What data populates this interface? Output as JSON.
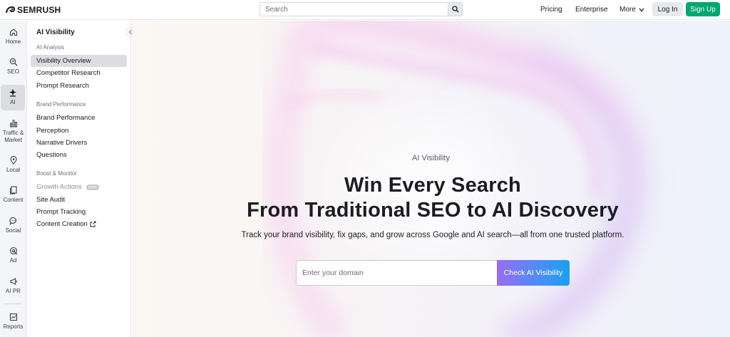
{
  "brand": {
    "name": "SEMRUSH"
  },
  "topbar": {
    "search_placeholder": "Search",
    "nav": {
      "pricing": "Pricing",
      "enterprise": "Enterprise",
      "more": "More"
    },
    "login": "Log In",
    "signup": "Sign Up"
  },
  "rail": {
    "items": [
      {
        "label": "Home",
        "icon": "home-icon"
      },
      {
        "label": "SEO",
        "icon": "seo-search-icon"
      },
      {
        "label": "AI",
        "icon": "ai-sparkle-icon",
        "active": true
      },
      {
        "label": "Traffic &",
        "label2": "Market",
        "icon": "bar-chart-icon"
      },
      {
        "label": "Local",
        "icon": "map-pin-icon"
      },
      {
        "label": "Content",
        "icon": "document-icon"
      },
      {
        "label": "Social",
        "icon": "chat-bubble-icon"
      },
      {
        "label": "Ad",
        "icon": "target-icon"
      },
      {
        "label": "AI PR",
        "icon": "megaphone-icon"
      },
      {
        "label": "Reports",
        "icon": "report-chart-icon"
      }
    ]
  },
  "subnav": {
    "title": "AI Visibility",
    "groups": [
      {
        "label": "AI Analysis",
        "items": [
          "Visibility Overview",
          "Competitor Research",
          "Prompt Research"
        ]
      },
      {
        "label": "Brand Performance",
        "items": [
          "Brand Performance",
          "Perception",
          "Narrative Drivers",
          "Questions"
        ]
      },
      {
        "label": "Boost & Monitor",
        "items": [
          "Growth Actions",
          "Site Audit",
          "Prompt Tracking",
          "Content Creation"
        ]
      }
    ],
    "active_item": "Visibility Overview",
    "soon_badge": "soon"
  },
  "hero": {
    "eyebrow": "AI Visibility",
    "headline_line1": "Win Every Search",
    "headline_line2": "From Traditional SEO to AI Discovery",
    "lead": "Track your brand visibility, fix gaps, and grow across Google and AI search—all from one trusted platform.",
    "domain_placeholder": "Enter your domain",
    "cta": "Check AI Visibility"
  },
  "colors": {
    "signup": "#00a66e",
    "cta_gradient_start": "#9b6cf2",
    "cta_gradient_end": "#1aa0f0",
    "rail_bg": "#f4f5f7"
  }
}
